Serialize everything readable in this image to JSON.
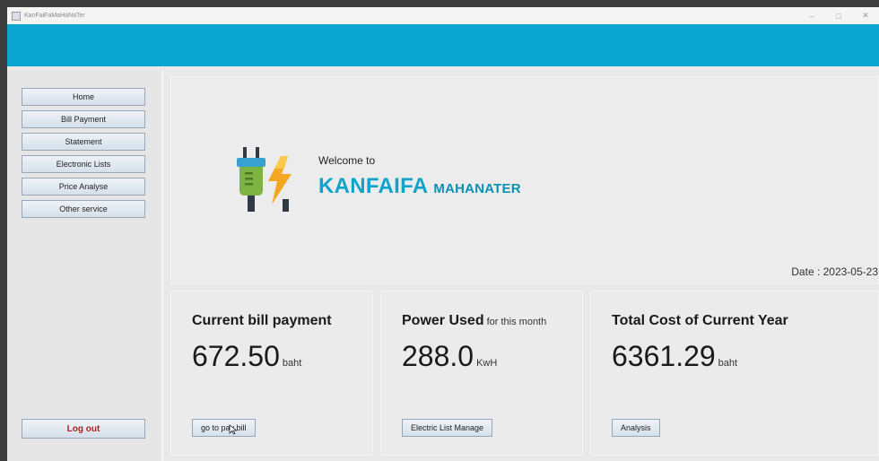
{
  "window": {
    "title": "KanFaiFaMaHaNaTer",
    "controls": [
      "–",
      "□",
      "✕"
    ]
  },
  "sidebar": {
    "items": [
      {
        "label": "Home"
      },
      {
        "label": "Bill Payment"
      },
      {
        "label": "Statement"
      },
      {
        "label": "Electronic Lists"
      },
      {
        "label": "Price Analyse"
      },
      {
        "label": "Other service"
      }
    ],
    "logout_label": "Log out"
  },
  "welcome": {
    "greeting": "Welcome to",
    "brand": "KANFAIFA",
    "brand_sub": "MAHANATER",
    "logo_icon": "plug-lightning-icon",
    "date_label": "Date : 2023-05-23"
  },
  "cards": [
    {
      "title": "Current bill payment",
      "subtitle": "",
      "value": "672.50",
      "unit": "baht",
      "button": "go to pay bill"
    },
    {
      "title": "Power Used",
      "subtitle": "for this month",
      "value": "288.0",
      "unit": "KwH",
      "button": "Electric List Manage"
    },
    {
      "title": "Total Cost of Current Year",
      "subtitle": "",
      "value": "6361.29",
      "unit": "baht",
      "button": "Analysis"
    }
  ],
  "colors": {
    "banner": "#0aa6cf",
    "brand": "#0fa3cc",
    "logout": "#b02020"
  }
}
